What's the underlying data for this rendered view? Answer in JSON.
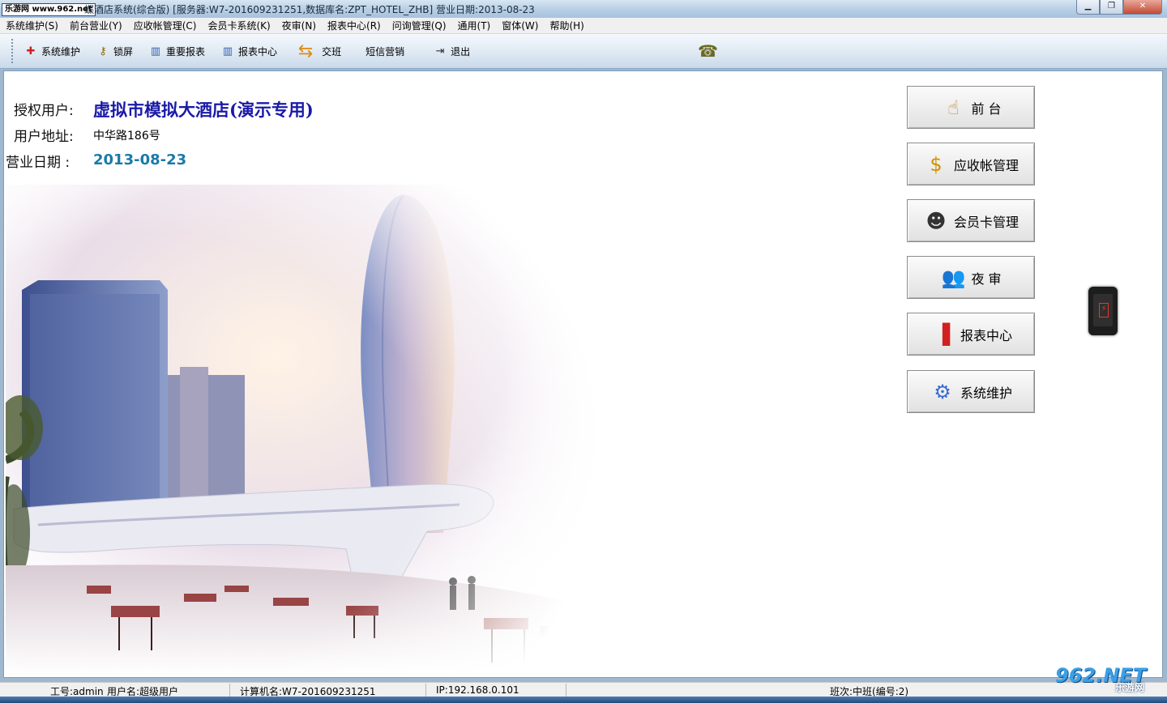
{
  "window": {
    "logo_text": "乐游网 www.962.net",
    "title": "蝶酒店系统(综合版)   [服务器:W7-201609231251,数据库名:ZPT_HOTEL_ZHB]  营业日期:2013-08-23",
    "min_glyph": "▁",
    "max_glyph": "❐",
    "close_glyph": "✕"
  },
  "menubar": {
    "items": [
      {
        "label": "系统维护(S)"
      },
      {
        "label": "前台营业(Y)"
      },
      {
        "label": "应收帐管理(C)"
      },
      {
        "label": "会员卡系统(K)"
      },
      {
        "label": "夜审(N)"
      },
      {
        "label": "报表中心(R)"
      },
      {
        "label": "问询管理(Q)"
      },
      {
        "label": "通用(T)"
      },
      {
        "label": "窗体(W)"
      },
      {
        "label": "帮助(H)"
      }
    ]
  },
  "toolbar": {
    "buttons": [
      {
        "label": "系统维护",
        "icon": "plus-icon",
        "glyph": "✚",
        "color": "#d02020"
      },
      {
        "label": "锁屏",
        "icon": "key-icon",
        "glyph": "⚷",
        "color": "#8a6a00"
      },
      {
        "label": "重要报表",
        "icon": "bar-chart-icon",
        "glyph": "▥",
        "color": "#3060b0"
      },
      {
        "label": "报表中心",
        "icon": "bar-chart-icon",
        "glyph": "▥",
        "color": "#3060b0"
      },
      {
        "label": "交班",
        "icon": "handover-icon",
        "glyph": "⇆",
        "color": "#e08a10"
      },
      {
        "label": "短信营销",
        "icon": "sms-icon",
        "glyph": "",
        "color": "#000000"
      },
      {
        "label": "退出",
        "icon": "exit-icon",
        "glyph": "⇥",
        "color": "#303030"
      }
    ],
    "phone_glyph": "☎"
  },
  "info": {
    "auth_label": "授权用户:",
    "hotel_name": "虚拟市模拟大酒店(演示专用)",
    "addr_label": "用户地址:",
    "address": "中华路186号",
    "date_label": "营业日期 :",
    "business_date": "2013-08-23"
  },
  "side_buttons": [
    {
      "label": "前 台",
      "icon": "front-desk-icon",
      "glyph": "☝",
      "color": "#c28a2a"
    },
    {
      "label": "应收帐管理",
      "icon": "money-check-icon",
      "glyph": "$",
      "color": "#d09000"
    },
    {
      "label": "会员卡管理",
      "icon": "member-card-icon",
      "glyph": "☻",
      "color": "#333333"
    },
    {
      "label": "夜 审",
      "icon": "users-icon",
      "glyph": "👥",
      "color": "#d07020"
    },
    {
      "label": "报表中心",
      "icon": "graph-icon",
      "glyph": "▐",
      "color": "#d02020"
    },
    {
      "label": "系统维护",
      "icon": "maintenance-icon",
      "glyph": "⚙",
      "color": "#3a6ad0"
    }
  ],
  "statusbar": {
    "user_id": "工号:admin",
    "user_name": "用户名:超级用户",
    "computer": "计算机名:W7-201609231251",
    "ip": "IP:192.168.0.101",
    "shift": "班次:中班(编号:2)"
  },
  "watermark": {
    "brand": "962.NET",
    "sub": "乐游网"
  },
  "floating_glyph": "⚡"
}
